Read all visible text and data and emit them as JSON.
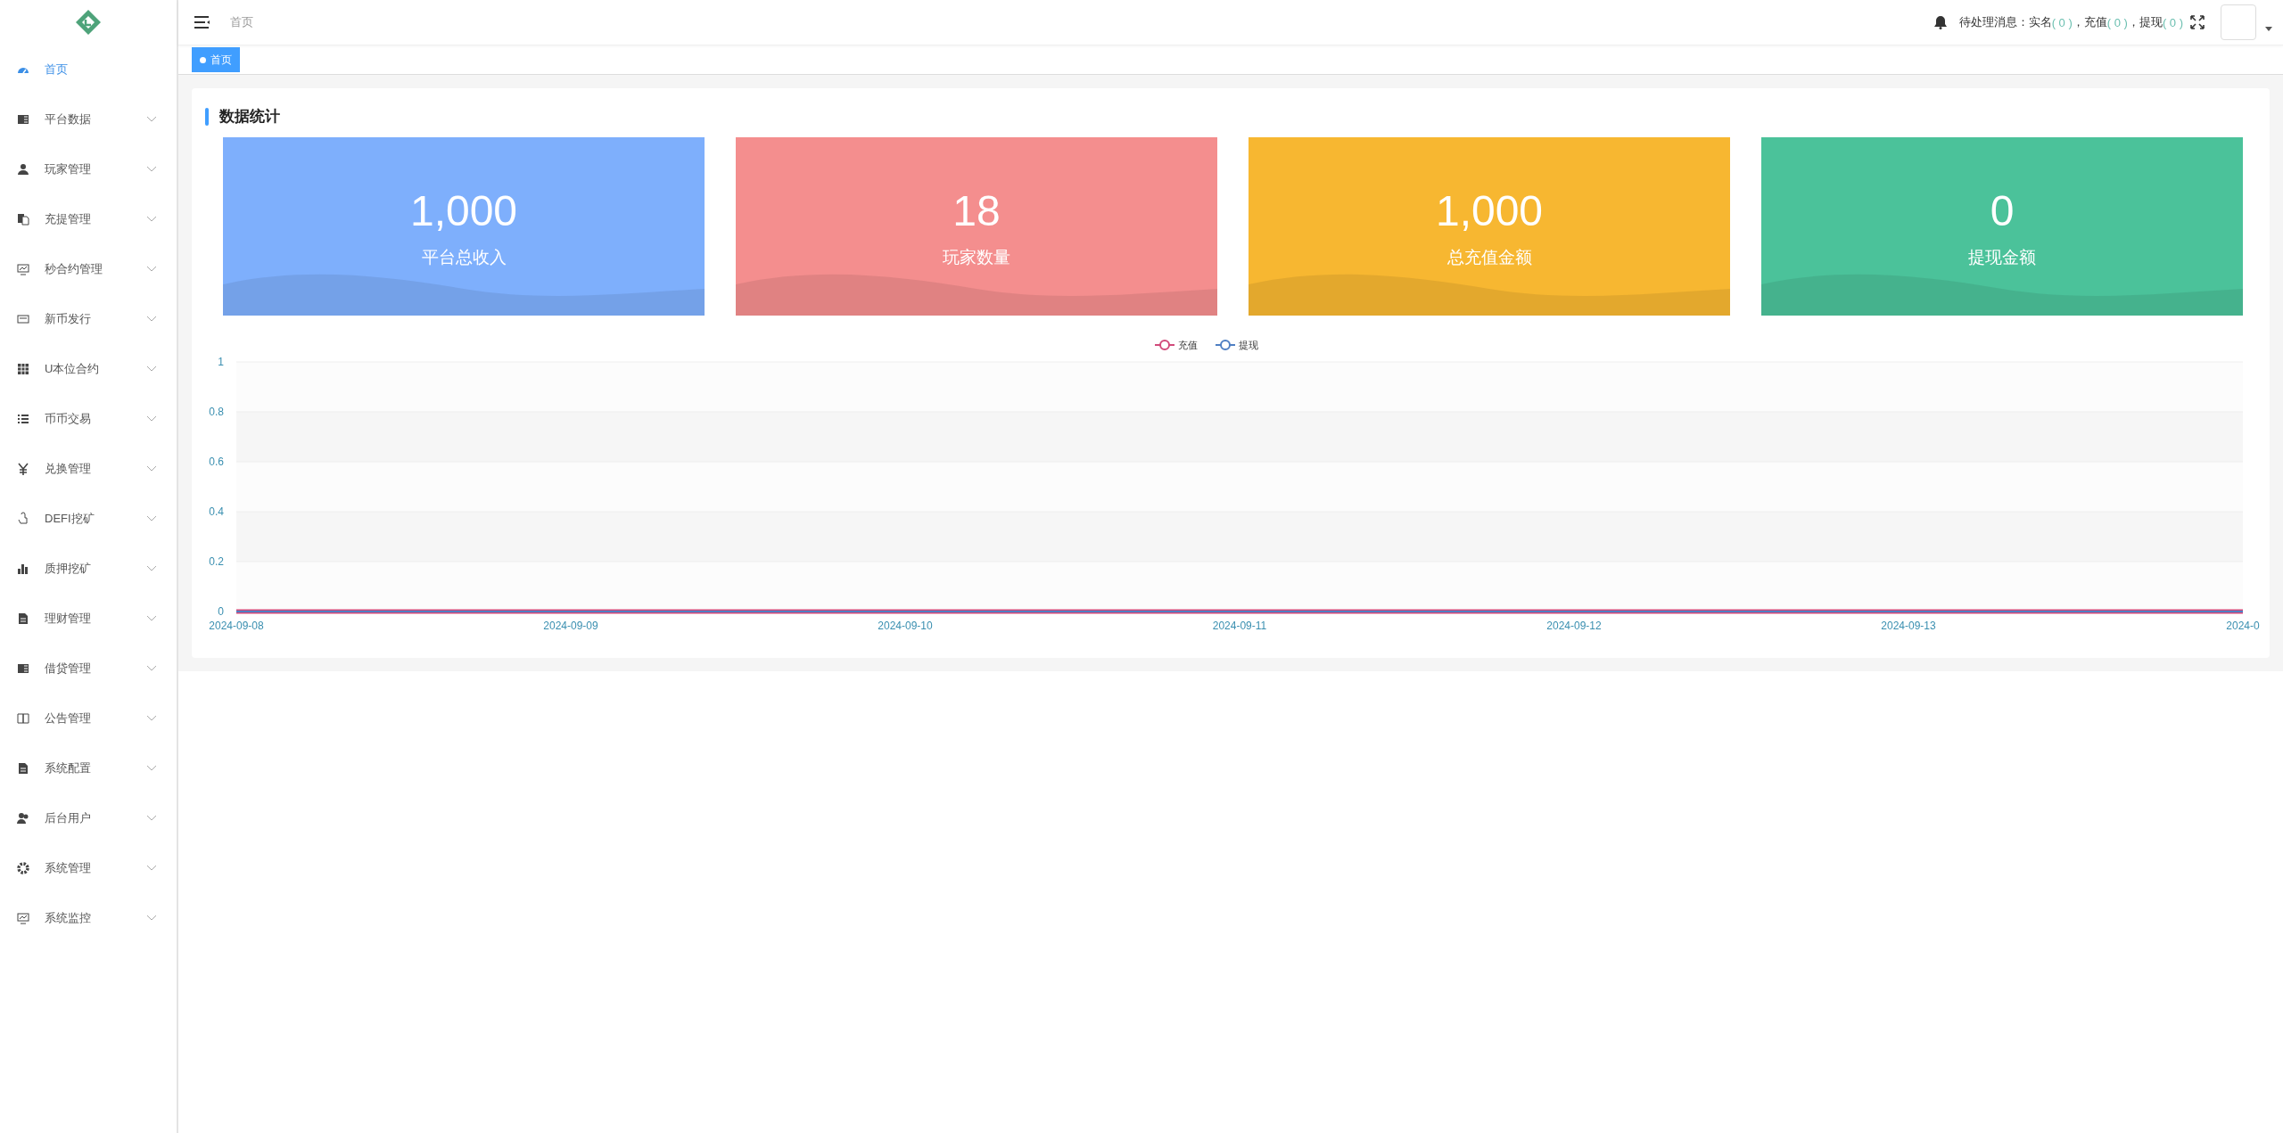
{
  "sidebar": {
    "items": [
      {
        "label": "首页",
        "selected": true,
        "has_children": false
      },
      {
        "label": "平台数据",
        "selected": false,
        "has_children": true
      },
      {
        "label": "玩家管理",
        "selected": false,
        "has_children": true
      },
      {
        "label": "充提管理",
        "selected": false,
        "has_children": true
      },
      {
        "label": "秒合约管理",
        "selected": false,
        "has_children": true
      },
      {
        "label": "新币发行",
        "selected": false,
        "has_children": true
      },
      {
        "label": "U本位合约",
        "selected": false,
        "has_children": true
      },
      {
        "label": "币币交易",
        "selected": false,
        "has_children": true
      },
      {
        "label": "兑换管理",
        "selected": false,
        "has_children": true
      },
      {
        "label": "DEFI挖矿",
        "selected": false,
        "has_children": true
      },
      {
        "label": "质押挖矿",
        "selected": false,
        "has_children": true
      },
      {
        "label": "理财管理",
        "selected": false,
        "has_children": true
      },
      {
        "label": "借贷管理",
        "selected": false,
        "has_children": true
      },
      {
        "label": "公告管理",
        "selected": false,
        "has_children": true
      },
      {
        "label": "系统配置",
        "selected": false,
        "has_children": true
      },
      {
        "label": "后台用户",
        "selected": false,
        "has_children": true
      },
      {
        "label": "系统管理",
        "selected": false,
        "has_children": true
      },
      {
        "label": "系统监控",
        "selected": false,
        "has_children": true
      }
    ]
  },
  "header": {
    "breadcrumb": "首页",
    "notice": {
      "label": "待处理消息：",
      "items": [
        {
          "label": "实名",
          "count": "( 0 )"
        },
        {
          "label": "，充值",
          "count": "( 0 )"
        },
        {
          "label": "，提现",
          "count": "( 0 )"
        }
      ]
    }
  },
  "tabs": [
    {
      "label": "首页",
      "selected": true
    }
  ],
  "panel": {
    "title": "数据统计",
    "cards": [
      {
        "value": "1,000",
        "label": "平台总收入",
        "color": "#7eaffc"
      },
      {
        "value": "18",
        "label": "玩家数量",
        "color": "#f48e8e"
      },
      {
        "value": "1,000",
        "label": "总充值金额",
        "color": "#f7b731"
      },
      {
        "value": "0",
        "label": "提现金额",
        "color": "#4bc29a"
      }
    ],
    "chart_data": {
      "type": "line",
      "categories": [
        "2024-09-08",
        "2024-09-09",
        "2024-09-10",
        "2024-09-11",
        "2024-09-12",
        "2024-09-13",
        "2024-0"
      ],
      "series": [
        {
          "name": "充值",
          "color": "#d14a7a",
          "values": [
            0,
            0,
            0,
            0,
            0,
            0,
            0
          ]
        },
        {
          "name": "提现",
          "color": "#4f7fc3",
          "values": [
            0,
            0,
            0,
            0,
            0,
            0,
            0
          ]
        }
      ],
      "ylim": [
        0,
        1
      ],
      "yticks": [
        0,
        0.2,
        0.4,
        0.6,
        0.8,
        1
      ],
      "grid": true,
      "legend": true
    }
  }
}
